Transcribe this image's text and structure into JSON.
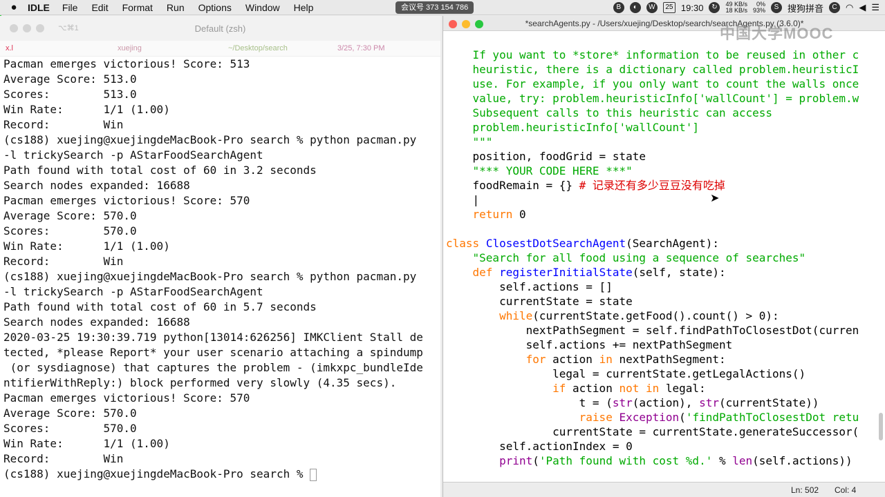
{
  "menubar": {
    "app_name": "IDLE",
    "menus": [
      "File",
      "Edit",
      "Format",
      "Run",
      "Options",
      "Window",
      "Help"
    ],
    "meeting_id": "会议号 373 154 786",
    "date_day": "25",
    "time": "19:30",
    "net_up": "49 KB/s",
    "net_down": "18 KB/s",
    "cpu_1": "0%",
    "cpu_2": "93%",
    "input_method": "搜狗拼音"
  },
  "terminal": {
    "shortcut": "⌥⌘1",
    "title": "Default (zsh)",
    "tabs": [
      "x.l",
      "xuejing",
      "~/Desktop/search",
      "3/25, 7:30 PM"
    ],
    "lines": [
      "Pacman emerges victorious! Score: 513",
      "Average Score: 513.0",
      "Scores:        513.0",
      "Win Rate:      1/1 (1.00)",
      "Record:        Win",
      "(cs188) xuejing@xuejingdeMacBook-Pro search % python pacman.py",
      "-l trickySearch -p AStarFoodSearchAgent",
      "Path found with total cost of 60 in 3.2 seconds",
      "Search nodes expanded: 16688",
      "Pacman emerges victorious! Score: 570",
      "Average Score: 570.0",
      "Scores:        570.0",
      "Win Rate:      1/1 (1.00)",
      "Record:        Win",
      "(cs188) xuejing@xuejingdeMacBook-Pro search % python pacman.py",
      "-l trickySearch -p AStarFoodSearchAgent",
      "Path found with total cost of 60 in 5.7 seconds",
      "Search nodes expanded: 16688",
      "2020-03-25 19:30:39.719 python[13014:626256] IMKClient Stall de",
      "tected, *please Report* your user scenario attaching a spindump",
      " (or sysdiagnose) that captures the problem - (imkxpc_bundleIde",
      "ntifierWithReply:) block performed very slowly (4.35 secs).",
      "Pacman emerges victorious! Score: 570",
      "Average Score: 570.0",
      "Scores:        570.0",
      "Win Rate:      1/1 (1.00)",
      "Record:        Win"
    ],
    "prompt": "(cs188) xuejing@xuejingdeMacBook-Pro search % "
  },
  "editor": {
    "title": "*searchAgents.py - /Users/xuejing/Desktop/search/searchAgents.py (3.6.0)*",
    "watermark": "中国大学MOOC",
    "status_line": "Ln: 502",
    "status_col": "Col: 4"
  }
}
